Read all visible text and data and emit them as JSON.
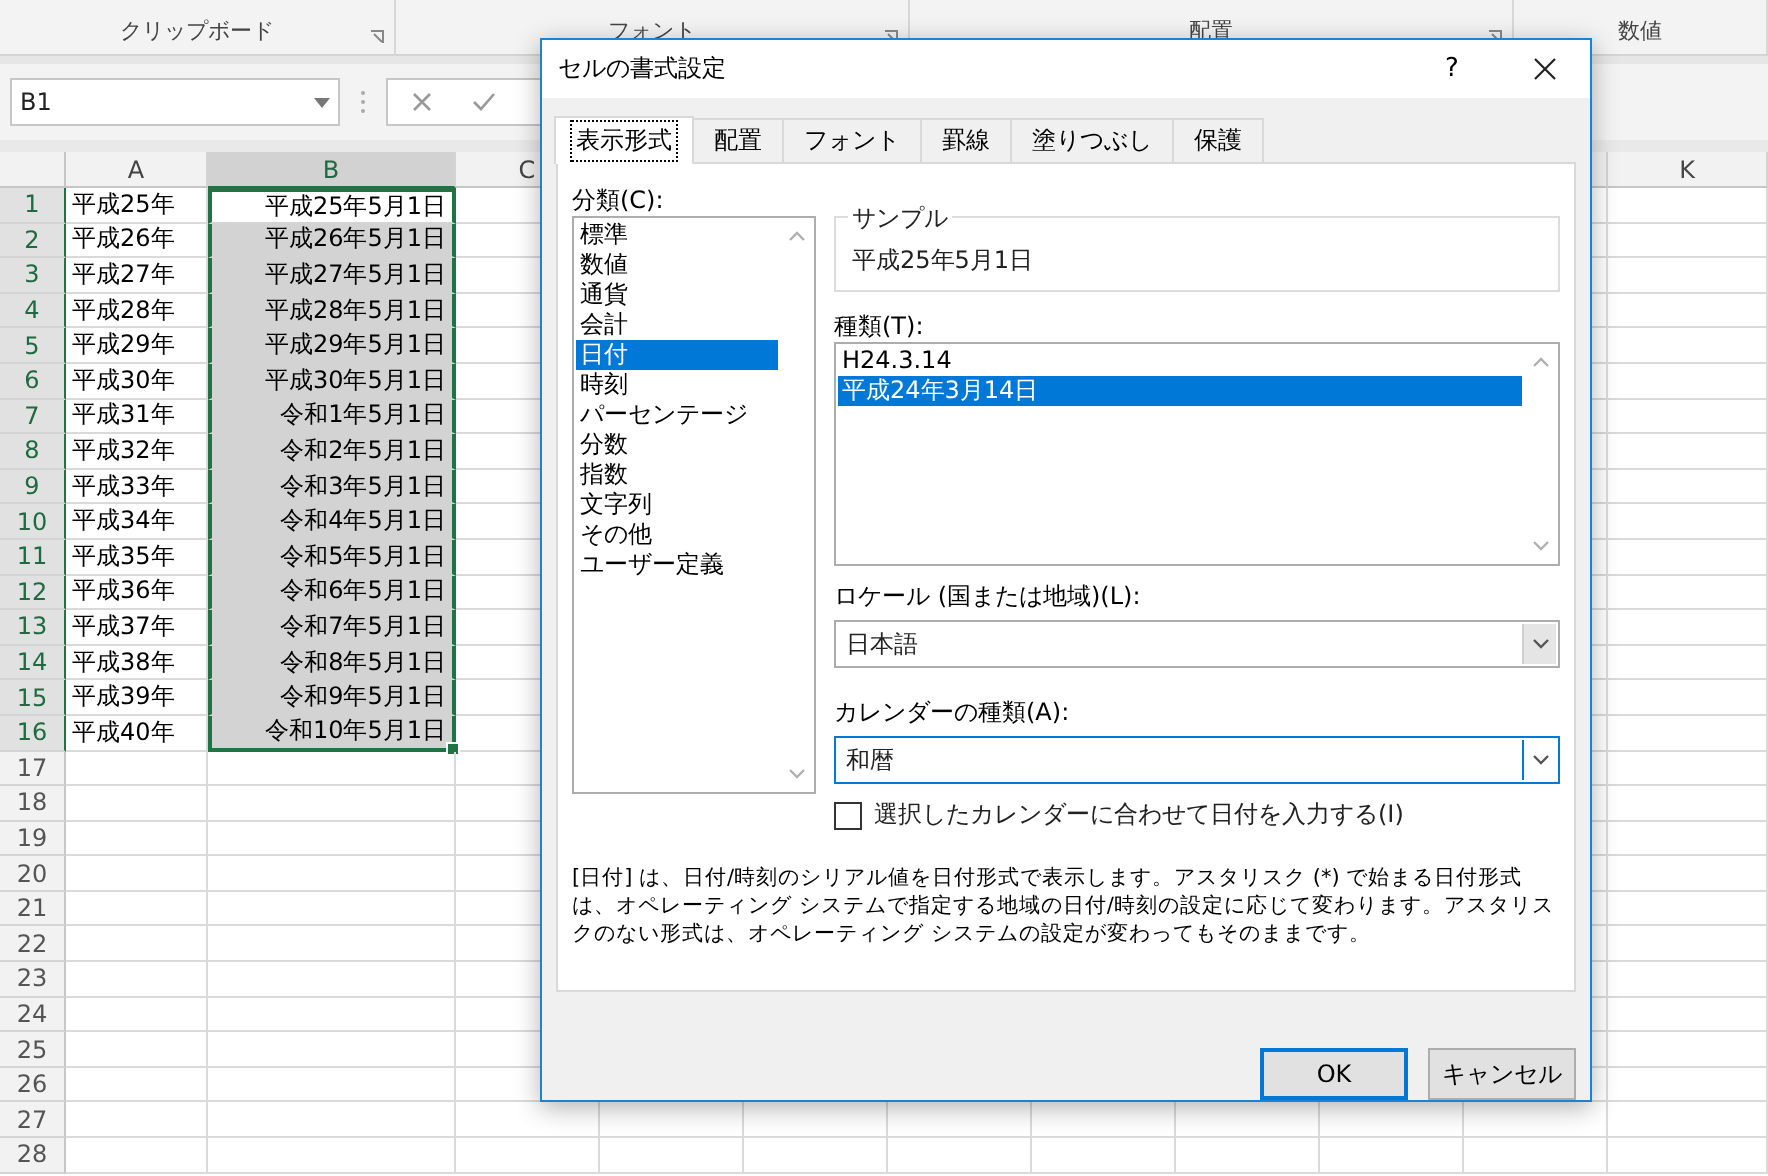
{
  "ribbon": {
    "groups": [
      {
        "label": "クリップボード"
      },
      {
        "label": "フォント"
      },
      {
        "label": "配置"
      },
      {
        "label": "数値"
      }
    ]
  },
  "name_box": {
    "value": "B1"
  },
  "sheet": {
    "columns": [
      {
        "label": "A",
        "selected": false
      },
      {
        "label": "B",
        "selected": true
      },
      {
        "label": "C",
        "selected": false
      },
      {
        "label": "K",
        "selected": false
      }
    ],
    "rows": [
      {
        "number": "1",
        "a": "平成25年",
        "b": "平成25年5月1日",
        "selected": true,
        "active": true
      },
      {
        "number": "2",
        "a": "平成26年",
        "b": "平成26年5月1日",
        "selected": true,
        "active": false
      },
      {
        "number": "3",
        "a": "平成27年",
        "b": "平成27年5月1日",
        "selected": true,
        "active": false
      },
      {
        "number": "4",
        "a": "平成28年",
        "b": "平成28年5月1日",
        "selected": true,
        "active": false
      },
      {
        "number": "5",
        "a": "平成29年",
        "b": "平成29年5月1日",
        "selected": true,
        "active": false
      },
      {
        "number": "6",
        "a": "平成30年",
        "b": "平成30年5月1日",
        "selected": true,
        "active": false
      },
      {
        "number": "7",
        "a": "平成31年",
        "b": "令和1年5月1日",
        "selected": true,
        "active": false
      },
      {
        "number": "8",
        "a": "平成32年",
        "b": "令和2年5月1日",
        "selected": true,
        "active": false
      },
      {
        "number": "9",
        "a": "平成33年",
        "b": "令和3年5月1日",
        "selected": true,
        "active": false
      },
      {
        "number": "10",
        "a": "平成34年",
        "b": "令和4年5月1日",
        "selected": true,
        "active": false
      },
      {
        "number": "11",
        "a": "平成35年",
        "b": "令和5年5月1日",
        "selected": true,
        "active": false
      },
      {
        "number": "12",
        "a": "平成36年",
        "b": "令和6年5月1日",
        "selected": true,
        "active": false
      },
      {
        "number": "13",
        "a": "平成37年",
        "b": "令和7年5月1日",
        "selected": true,
        "active": false
      },
      {
        "number": "14",
        "a": "平成38年",
        "b": "令和8年5月1日",
        "selected": true,
        "active": false
      },
      {
        "number": "15",
        "a": "平成39年",
        "b": "令和9年5月1日",
        "selected": true,
        "active": false
      },
      {
        "number": "16",
        "a": "平成40年",
        "b": "令和10年5月1日",
        "selected": true,
        "active": false
      },
      {
        "number": "17",
        "selected": false,
        "active": false
      },
      {
        "number": "18",
        "selected": false,
        "active": false
      },
      {
        "number": "19",
        "selected": false,
        "active": false
      },
      {
        "number": "20",
        "selected": false,
        "active": false
      },
      {
        "number": "21",
        "selected": false,
        "active": false
      },
      {
        "number": "22",
        "selected": false,
        "active": false
      },
      {
        "number": "23",
        "selected": false,
        "active": false
      },
      {
        "number": "24",
        "selected": false,
        "active": false
      },
      {
        "number": "25",
        "selected": false,
        "active": false
      },
      {
        "number": "26",
        "selected": false,
        "active": false
      },
      {
        "number": "27",
        "selected": false,
        "active": false
      },
      {
        "number": "28",
        "selected": false,
        "active": false
      }
    ]
  },
  "dialog": {
    "title": "セルの書式設定",
    "help": "?",
    "tabs": [
      {
        "label": "表示形式",
        "selected": true
      },
      {
        "label": "配置",
        "selected": false
      },
      {
        "label": "フォント",
        "selected": false
      },
      {
        "label": "罫線",
        "selected": false
      },
      {
        "label": "塗りつぶし",
        "selected": false
      },
      {
        "label": "保護",
        "selected": false
      }
    ],
    "category_label": "分類(C):",
    "categories": [
      {
        "label": "標準",
        "selected": false
      },
      {
        "label": "数値",
        "selected": false
      },
      {
        "label": "通貨",
        "selected": false
      },
      {
        "label": "会計",
        "selected": false
      },
      {
        "label": "日付",
        "selected": true
      },
      {
        "label": "時刻",
        "selected": false
      },
      {
        "label": "パーセンテージ",
        "selected": false
      },
      {
        "label": "分数",
        "selected": false
      },
      {
        "label": "指数",
        "selected": false
      },
      {
        "label": "文字列",
        "selected": false
      },
      {
        "label": "その他",
        "selected": false
      },
      {
        "label": "ユーザー定義",
        "selected": false
      }
    ],
    "sample": {
      "legend": "サンプル",
      "value": "平成25年5月1日"
    },
    "type_label": "種類(T):",
    "types": [
      {
        "label": "H24.3.14",
        "selected": false
      },
      {
        "label": "平成24年3月14日",
        "selected": true
      }
    ],
    "locale": {
      "label": "ロケール (国または地域)(L):",
      "value": "日本語",
      "focused": false
    },
    "calendar": {
      "label": "カレンダーの種類(A):",
      "value": "和暦",
      "focused": true
    },
    "checkbox": {
      "label": "選択したカレンダーに合わせて日付を入力する(I)",
      "checked": false
    },
    "description": "[日付] は、日付/時刻のシリアル値を日付形式で表示します。アスタリスク (*) で始まる日付形式は、オペレーティング システムで指定する地域の日付/時刻の設定に応じて変わります。アスタリスクのない形式は、オペレーティング システムの設定が変わってもそのままです。",
    "buttons": [
      {
        "label": "OK",
        "default": true
      },
      {
        "label": "キャンセル",
        "default": false
      }
    ]
  }
}
